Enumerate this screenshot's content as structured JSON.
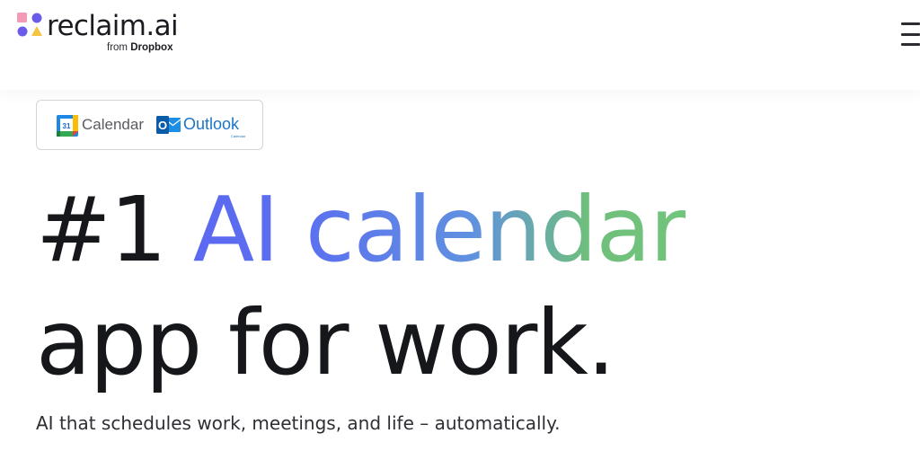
{
  "brand": {
    "name": "reclaim.ai",
    "from_label": "from",
    "parent": "Dropbox",
    "colors": {
      "pink": "#f29ab6",
      "purple": "#6a5ce8",
      "yellow": "#f5c542"
    }
  },
  "header": {
    "menu_icon": "hamburger-menu-icon"
  },
  "integrations": {
    "google": {
      "icon": "google-calendar-icon",
      "day": "31",
      "label": "Calendar"
    },
    "outlook": {
      "icon": "outlook-icon",
      "letter": "O",
      "label": "Outlook",
      "sublabel": "Calendar"
    }
  },
  "hero": {
    "line1_prefix": "#1",
    "line1_gradient": "AI calendar",
    "line2": "app for work.",
    "subtitle": "AI that schedules work, meetings, and life – automatically.",
    "gradient_colors": [
      "#5b69f0",
      "#6091e0",
      "#73c97a"
    ],
    "text_color": "#16171b"
  }
}
